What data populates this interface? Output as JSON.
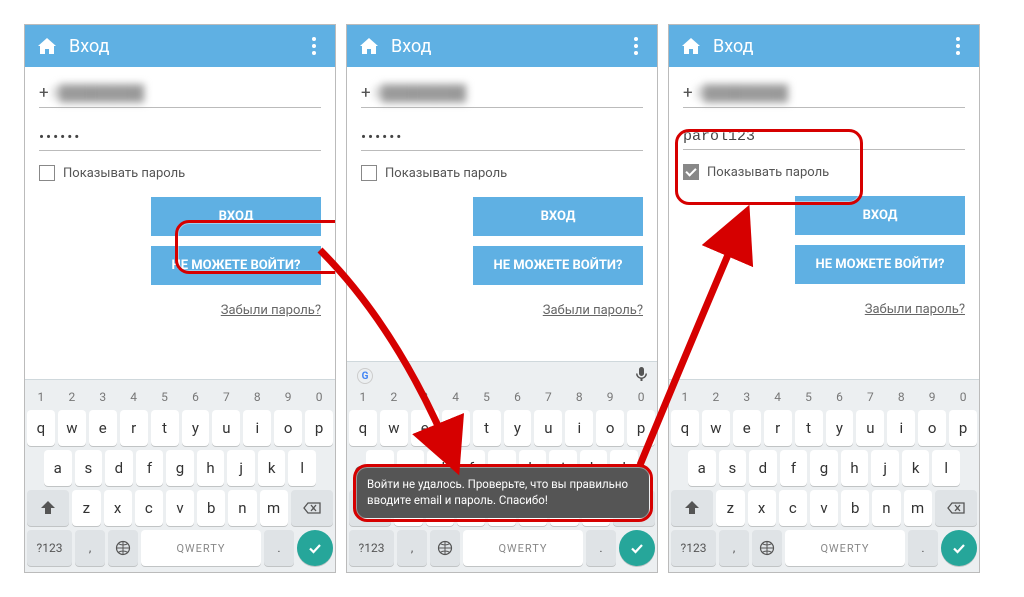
{
  "appbar": {
    "title": "Вход"
  },
  "form": {
    "email_prefix": "+",
    "email_masked": "3████████",
    "password_hidden": "••••••",
    "password_revealed": "parol123",
    "show_pw_label": "Показывать пароль",
    "login_btn": "ВХОД",
    "cant_login_btn": "НЕ МОЖЕТЕ ВОЙТИ?",
    "forgot": "Забыли пароль?"
  },
  "toast": {
    "text": "Войти не удалось. Проверьте, что вы правильно вводите email и пароль. Спасибо!"
  },
  "keyboard": {
    "nums": [
      "1",
      "2",
      "3",
      "4",
      "5",
      "6",
      "7",
      "8",
      "9",
      "0"
    ],
    "row1": [
      "q",
      "w",
      "e",
      "r",
      "t",
      "y",
      "u",
      "i",
      "o",
      "p"
    ],
    "row2": [
      "a",
      "s",
      "d",
      "f",
      "g",
      "h",
      "j",
      "k",
      "l"
    ],
    "row3": [
      "z",
      "x",
      "c",
      "v",
      "b",
      "n",
      "m"
    ],
    "sym": "?123",
    "space": "QWERTY",
    "period": ".",
    "comma": ",",
    "enter": "✓"
  }
}
